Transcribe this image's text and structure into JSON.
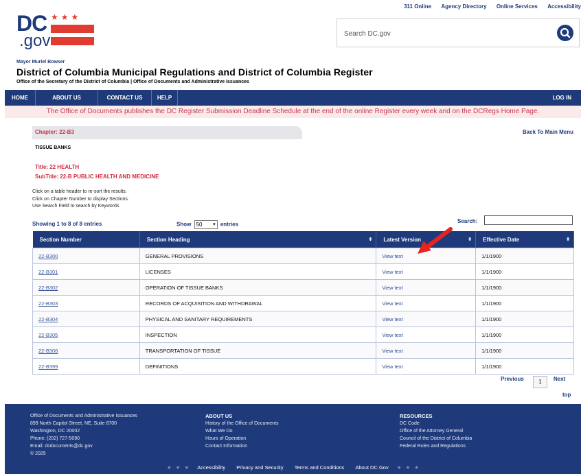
{
  "utility": [
    "311 Online",
    "Agency Directory",
    "Online Services",
    "Accessibility"
  ],
  "logo": {
    "main": "DC",
    "sub": ".gov",
    "stars": "★★★"
  },
  "search": {
    "placeholder": "Search DC.gov",
    "icon": "magnifier-icon"
  },
  "header": {
    "mayor": "Mayor Muriel Bowser",
    "title": "District of Columbia Municipal Regulations and District of Columbia Register",
    "subtitle": "Office of the Secretary of the District of Columbia | Office of Documents and Administrative Issuances"
  },
  "nav": {
    "items": [
      "HOME",
      "ABOUT US",
      "CONTACT US",
      "HELP"
    ],
    "login": "LOG IN"
  },
  "notice": "The Office of Documents publishes the DC Register Submission Deadline Schedule at the end of the online Register every week and on the DCRegs Home Page.",
  "chapter": {
    "tab": "Chapter: 22-B3",
    "back": "Back To Main Menu",
    "heading": "TISSUE BANKS",
    "title": "Title: 22 HEALTH",
    "subtitle": "SubTitle: 22-B PUBLIC HEALTH AND MEDICINE"
  },
  "instructions": [
    "Click on a table header to re-sort the results.",
    "Click on Chapter Number to display Sections.",
    "Use Search Field to search by Keywords"
  ],
  "table": {
    "showing": "Showing 1 to 8 of 8 entries",
    "show_prefix": "Show",
    "show_value": "50",
    "show_suffix": "entries",
    "search_label": "Search:",
    "columns": [
      "Section Number",
      "Section Heading",
      "Latest Version",
      "Effective Date"
    ],
    "rows": [
      {
        "number": "22-B300",
        "heading": "GENERAL PROVISIONS",
        "version": "View text",
        "date": "1/1/1900"
      },
      {
        "number": "22-B301",
        "heading": "LICENSES",
        "version": "View text",
        "date": "1/1/1900"
      },
      {
        "number": "22-B302",
        "heading": "OPERATION OF TISSUE BANKS",
        "version": "View text",
        "date": "1/1/1900"
      },
      {
        "number": "22-B303",
        "heading": "RECORDS OF ACQUISITION AND WITHDRAWAL",
        "version": "View text",
        "date": "1/1/1900"
      },
      {
        "number": "22-B304",
        "heading": "PHYSICAL AND SANITARY REQUIREMENTS",
        "version": "View text",
        "date": "1/1/1900"
      },
      {
        "number": "22-B305",
        "heading": "INSPECTION",
        "version": "View text",
        "date": "1/1/1900"
      },
      {
        "number": "22-B306",
        "heading": "TRANSPORTATION OF TISSUE",
        "version": "View text",
        "date": "1/1/1900"
      },
      {
        "number": "22-B399",
        "heading": "DEFINITIONS",
        "version": "View text",
        "date": "1/1/1900"
      }
    ]
  },
  "pager": {
    "previous": "Previous",
    "page": "1",
    "next": "Next",
    "top": "top"
  },
  "footer": {
    "address": [
      "Office of Documents and Administrative Issuances",
      "899 North Capitol Street, NE, Suite 8700",
      "Washington, DC 20002",
      "Phone: (202) 727-5090",
      "Email: dcdocuments@dc.gov",
      "© 2025"
    ],
    "about_title": "ABOUT US",
    "about_links": [
      "History of the Office of Documents",
      "What We Do",
      "Hours of Operation",
      "Contact Information"
    ],
    "resources_title": "RESOURCES",
    "resources_links": [
      "DC Code",
      "Office of the Attorney General",
      "Council of the District of Columbia",
      "Federal Rules and Regulations"
    ],
    "bottom_links": [
      "Accessibility",
      "Privacy and Security",
      "Terms and Conditions",
      "About DC.Gov"
    ],
    "star": "★"
  },
  "colors": {
    "brand_blue": "#1f3a7a",
    "brand_red": "#e03c31",
    "notice_text": "#c4384a"
  }
}
